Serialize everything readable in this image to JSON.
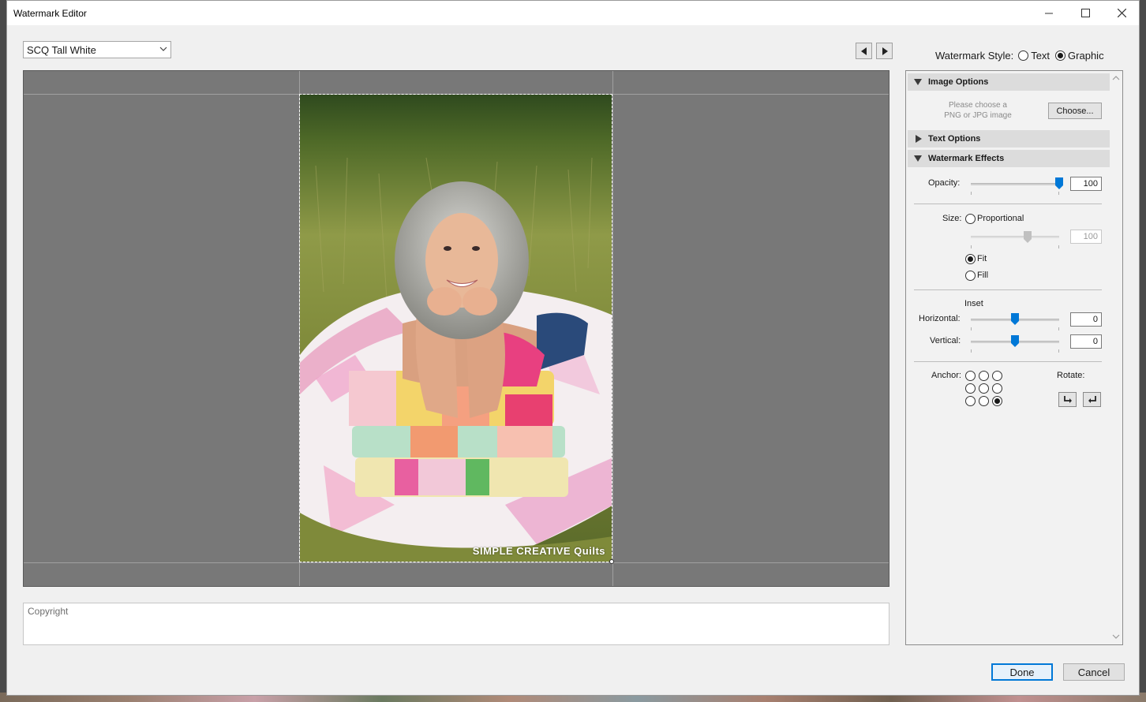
{
  "window": {
    "title": "Watermark Editor"
  },
  "toolbar": {
    "preset": "SCQ Tall White"
  },
  "style": {
    "label": "Watermark Style:",
    "options": [
      "Text",
      "Graphic"
    ],
    "selected": "Graphic"
  },
  "preview": {
    "watermark_text": "SIMPLE CREATIVE Quilts"
  },
  "copyright": {
    "placeholder": "Copyright"
  },
  "image_options": {
    "header": "Image Options",
    "hint_line1": "Please choose a",
    "hint_line2": "PNG or JPG image",
    "choose_label": "Choose..."
  },
  "text_options": {
    "header": "Text Options"
  },
  "effects": {
    "header": "Watermark Effects",
    "opacity": {
      "label": "Opacity:",
      "value": "100",
      "level": 1.0
    },
    "size": {
      "label": "Size:",
      "proportional_label": "Proportional",
      "proportional_value": "100",
      "fit_label": "Fit",
      "fill_label": "Fill",
      "selected": "Fit"
    },
    "inset": {
      "label": "Inset",
      "horizontal_label": "Horizontal:",
      "horizontal_value": "0",
      "vertical_label": "Vertical:",
      "vertical_value": "0"
    },
    "anchor": {
      "label": "Anchor:",
      "selected": "bottom-right"
    },
    "rotate": {
      "label": "Rotate:"
    }
  },
  "footer": {
    "done_label": "Done",
    "cancel_label": "Cancel"
  },
  "colors": {
    "accent": "#0078d7",
    "preview_bg": "#787878",
    "slider_thumb": "#0078d7"
  }
}
